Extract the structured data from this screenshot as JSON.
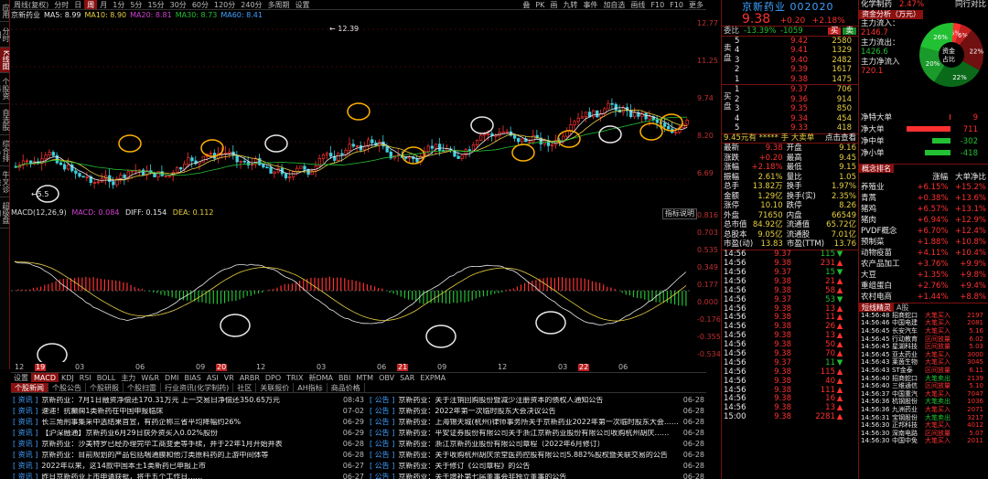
{
  "sidebar": {
    "items": [
      {
        "label": "应用",
        "active": false
      },
      {
        "label": "分时图",
        "active": false
      },
      {
        "label": "K线图",
        "active": true
      },
      {
        "label": "个股资料",
        "active": false
      },
      {
        "label": "自选股",
        "active": false
      },
      {
        "label": "综合排名",
        "active": false
      },
      {
        "label": "牛叉诊股",
        "active": false
      },
      {
        "label": "超级盘口",
        "active": false
      }
    ]
  },
  "toolbar": {
    "periods": [
      "周线(复权)",
      "分时",
      "日",
      "周",
      "月",
      "1分",
      "5分",
      "15分",
      "30分",
      "60分",
      "120分",
      "240分",
      "多周期",
      "设置"
    ],
    "active_period": "周",
    "right_buttons": [
      "叠",
      "PK",
      "画",
      "九转",
      "事件",
      "加自选",
      "画线",
      "F10",
      "F10",
      "更多"
    ]
  },
  "ma_line": {
    "stock": "京新药业",
    "items": [
      {
        "label": "MA5: 8.99",
        "color": "#e8e8e8"
      },
      {
        "label": "MA10: 8.90",
        "color": "#e8d040"
      },
      {
        "label": "MA20: 8.81",
        "color": "#d040d0"
      },
      {
        "label": "MA30: 8.73",
        "color": "#22c033"
      },
      {
        "label": "MA60: 8.41",
        "color": "#40a0ff"
      }
    ]
  },
  "chart_axis": {
    "price_ticks": [
      "12.77",
      "11.25",
      "9.74",
      "8.20",
      "6.69"
    ],
    "high_label": "12.39",
    "low_label": "5.5",
    "macd_ticks": [
      "0.816",
      "0.703",
      "0.535",
      "0.349",
      "0.177",
      "0.000",
      "-0.176",
      "-0.355",
      "-0.534"
    ],
    "time_labels": [
      "12",
      "03",
      "06",
      "09",
      "12",
      "03",
      "06",
      "09",
      "12",
      "03",
      "06"
    ],
    "year_badges": [
      "19",
      "20",
      "21",
      "22"
    ],
    "indicator_btn": "指标说明"
  },
  "macd": {
    "title": "MACD(12,26,9)",
    "macd_val": "MACD: 0.084",
    "diff": "DIFF: 0.154",
    "dea": "DEA: 0.112"
  },
  "indicators": {
    "items": [
      "设置",
      "MACD",
      "KDJ",
      "RSI",
      "BOLL",
      "主力",
      "W&R",
      "DMI",
      "BIAS",
      "ASI",
      "VR",
      "ARBR",
      "DPO",
      "TRIX",
      "新DMA",
      "BBI",
      "MTM",
      "OBV",
      "SAR",
      "EXPMA"
    ],
    "active": "MACD"
  },
  "news_tabs": {
    "items": [
      "个股新闻",
      "个股公告",
      "个股研报",
      "个股扫雷",
      "行业资讯(化学制药)",
      "社区",
      "关联报价",
      "AH指标",
      "商品价格"
    ],
    "active": "个股新闻"
  },
  "news": [
    {
      "tag": "资讯",
      "title": "京新药业：7月1日融资净偿还170.31万元 上一交易日净偿还350.65万元",
      "time": "08:43"
    },
    {
      "tag": "资讯",
      "title": "速递！抗癫痫1类新药在中国申报临床",
      "time": "07-02"
    },
    {
      "tag": "资讯",
      "title": "长三角刑事集采中选结果首宣，有药企称三省平均降幅约26%",
      "time": "06-29"
    },
    {
      "tag": "资讯",
      "title": "【沪深融通】京新药业6月29日获外资买入0.02%股份",
      "time": "06-29"
    },
    {
      "tag": "资讯",
      "title": "京新药业：沙美特罗已经办理完毕工商变更等手续，并于22年1月开始并表",
      "time": "06-28"
    },
    {
      "tag": "资讯",
      "title": "京新药业：目前规划的产品包括喘通膜和他汀类原料药的上游中间体等",
      "time": "06-28"
    },
    {
      "tag": "资讯",
      "title": "2022年以来，这14款中国本土1类新药已申报上市",
      "time": "06-27"
    },
    {
      "tag": "资讯",
      "title": "昨日京新药业上市申请获批，将于五个工作日……",
      "time": "06-27"
    }
  ],
  "notices": [
    {
      "tag": "公告",
      "title": "京新药业：关于注销回购股份暨减少注册资本的债权人通知公告",
      "time": "06-28"
    },
    {
      "tag": "公告",
      "title": "京新药业：2022年第一次临时股东大会决议公告",
      "time": "06-28"
    },
    {
      "tag": "公告",
      "title": "京新药业：上海锦天城(杭州)律师事务所关于京新药业2022年第一次临时股东大会……",
      "time": "06-28"
    },
    {
      "tag": "公告",
      "title": "京新药业：平安证券股份有限公司关于浙江京新药业股份有限公司收购杭州胡庆……",
      "time": "06-28"
    },
    {
      "tag": "公告",
      "title": "京新药业：浙江京新药业股份有限公司章程（2022年6月修订）",
      "time": "06-28"
    },
    {
      "tag": "公告",
      "title": "京新药业：关于收购杭州胡庆余堂医药控股有限公司5.882%股权暨关联交易的公告",
      "time": "06-28"
    },
    {
      "tag": "公告",
      "title": "京新药业：关于修订《公司章程》的公告",
      "time": "06-28"
    },
    {
      "tag": "公告",
      "title": "京新药业：关于增补第七届董事会非独立董事的公告",
      "time": "06-28"
    }
  ],
  "stock": {
    "name": "京新药业 002020",
    "price": "9.38",
    "change": "+0.20",
    "pct": "+2.18%",
    "weibi": "委比",
    "weibi_pct": "-13.39%",
    "weibi_val": "-1059",
    "buy_btn": "买",
    "sell_btn": "卖",
    "sells": [
      {
        "lvl": "5",
        "price": "9.42",
        "vol": "2580"
      },
      {
        "lvl": "4",
        "price": "9.41",
        "vol": "1329"
      },
      {
        "lvl": "3",
        "price": "9.40",
        "vol": "2482"
      },
      {
        "lvl": "2",
        "price": "9.39",
        "vol": "1617"
      },
      {
        "lvl": "1",
        "price": "9.38",
        "vol": "1475"
      }
    ],
    "buys": [
      {
        "lvl": "1",
        "price": "9.37",
        "vol": "706"
      },
      {
        "lvl": "2",
        "price": "9.36",
        "vol": "914"
      },
      {
        "lvl": "3",
        "price": "9.35",
        "vol": "850"
      },
      {
        "lvl": "4",
        "price": "9.34",
        "vol": "454"
      },
      {
        "lvl": "5",
        "price": "9.33",
        "vol": "418"
      }
    ],
    "sell_side_label": "卖盘",
    "buy_side_label": "买盘",
    "mini_hdr": "9.45元有 ***** 手 大卖单",
    "mini_hdr_right": "点击查看",
    "stats": [
      {
        "k": "最新",
        "v": "9.38",
        "k2": "开盘",
        "v2": "9.16"
      },
      {
        "k": "涨跌",
        "v": "+0.20",
        "k2": "最高",
        "v2": "9.45"
      },
      {
        "k": "涨幅",
        "v": "+2.18%",
        "k2": "最低",
        "v2": "9.15"
      },
      {
        "k": "振幅",
        "v": "2.61%",
        "k2": "量比",
        "v2": "1.05"
      },
      {
        "k": "总手",
        "v": "13.82万",
        "k2": "换手",
        "v2": "1.97%"
      },
      {
        "k": "金额",
        "v": "1.29亿",
        "k2": "换手(实)",
        "v2": "2.35%"
      },
      {
        "k": "涨停",
        "v": "10.10",
        "k2": "跌停",
        "v2": "8.26"
      },
      {
        "k": "外盘",
        "v": "71650",
        "k2": "内盘",
        "v2": "66549"
      },
      {
        "k": "总市值",
        "v": "84.92亿",
        "k2": "流通值",
        "v2": "65.72亿"
      },
      {
        "k": "总股本",
        "v": "9.05亿",
        "k2": "流通股",
        "v2": "7.01亿"
      },
      {
        "k": "市盈(动)",
        "v": "13.83",
        "k2": "市盈(TTM)",
        "v2": "13.76"
      }
    ],
    "ticks": [
      {
        "t": "14:56",
        "p": "9.37",
        "v": "115",
        "d": "s"
      },
      {
        "t": "14:56",
        "p": "9.38",
        "v": "231",
        "d": "b"
      },
      {
        "t": "14:56",
        "p": "9.37",
        "v": "15",
        "d": "s"
      },
      {
        "t": "14:56",
        "p": "9.38",
        "v": "21",
        "d": "b"
      },
      {
        "t": "14:56",
        "p": "9.38",
        "v": "58",
        "d": "b"
      },
      {
        "t": "14:56",
        "p": "9.37",
        "v": "53",
        "d": "s"
      },
      {
        "t": "14:56",
        "p": "9.38",
        "v": "13",
        "d": "b"
      },
      {
        "t": "14:56",
        "p": "9.38",
        "v": "11",
        "d": "b"
      },
      {
        "t": "14:56",
        "p": "9.38",
        "v": "26",
        "d": "b"
      },
      {
        "t": "14:56",
        "p": "9.38",
        "v": "13",
        "d": "b"
      },
      {
        "t": "14:56",
        "p": "9.38",
        "v": "50",
        "d": "b"
      },
      {
        "t": "14:56",
        "p": "9.38",
        "v": "70",
        "d": "b"
      },
      {
        "t": "14:56",
        "p": "9.37",
        "v": "11",
        "d": "s"
      },
      {
        "t": "14:56",
        "p": "9.38",
        "v": "115",
        "d": "b"
      },
      {
        "t": "14:56",
        "p": "9.38",
        "v": "40",
        "d": "b"
      },
      {
        "t": "14:56",
        "p": "9.38",
        "v": "111",
        "d": "b"
      },
      {
        "t": "14:56",
        "p": "9.38",
        "v": "16",
        "d": "b"
      },
      {
        "t": "14:56",
        "p": "9.38",
        "v": "13",
        "d": "b"
      },
      {
        "t": "15:00",
        "p": "9.38",
        "v": "2281",
        "d": "b"
      }
    ]
  },
  "fund": {
    "industry": "化学制药",
    "industry_pct": "2.47%",
    "industry_link": "同行对比",
    "tabs": [
      "资金分析（万元）"
    ],
    "main_in_lbl": "主力流入：",
    "main_in": "2146.7",
    "main_out_lbl": "主力流出：",
    "main_out": "1426.6",
    "main_net_lbl": "主力净流入",
    "main_net": "720.1",
    "pie_center": "资金占比",
    "pie_pcts": [
      "5%",
      "6%",
      "22%",
      "22%",
      "20%",
      "26%"
    ],
    "flows": [
      {
        "k": "净特大单",
        "v": "9",
        "frac": 0.01,
        "color": "#ff3030"
      },
      {
        "k": "净大单",
        "v": "711",
        "frac": 0.85,
        "color": "#ff3030"
      },
      {
        "k": "净中单",
        "v": "-302",
        "frac": 0.35,
        "color": "#22c033"
      },
      {
        "k": "净小单",
        "v": "-418",
        "frac": 0.5,
        "color": "#22c033"
      }
    ],
    "rank_title": "概念排名",
    "rank_cols": [
      "涨幅",
      "大单净比"
    ],
    "ranks": [
      {
        "n": "养殖业",
        "a": "+6.15%",
        "b": "+15.2%"
      },
      {
        "n": "青蒿",
        "a": "+0.38%",
        "b": "+13.6%"
      },
      {
        "n": "猪鸡",
        "a": "+6.57%",
        "b": "+13.1%"
      },
      {
        "n": "猪肉",
        "a": "+6.94%",
        "b": "+12.9%"
      },
      {
        "n": "PVDF概念",
        "a": "+6.70%",
        "b": "+12.4%"
      },
      {
        "n": "预制菜",
        "a": "+1.88%",
        "b": "+10.8%"
      },
      {
        "n": "动物疫苗",
        "a": "+4.11%",
        "b": "+10.4%"
      },
      {
        "n": "农产品加工",
        "a": "+3.76%",
        "b": "+9.9%"
      },
      {
        "n": "大豆",
        "a": "+1.35%",
        "b": "+9.8%"
      },
      {
        "n": "重组蛋白",
        "a": "+2.76%",
        "b": "+9.4%"
      },
      {
        "n": "农村电商",
        "a": "+1.44%",
        "b": "+8.8%"
      }
    ],
    "mini_tabs": [
      "短线精灵",
      "A股"
    ],
    "alerts": [
      {
        "t": "14:56:48",
        "n": "招商蛇口",
        "e": "大笔买入",
        "v": "2197"
      },
      {
        "t": "14:56:46",
        "n": "中国电建",
        "e": "大笔买入",
        "v": "2081"
      },
      {
        "t": "14:56:45",
        "n": "长安汽车",
        "e": "大笔买入",
        "v": "5.16"
      },
      {
        "t": "14:56:45",
        "n": "行动教育",
        "e": "区间放量",
        "v": "6.02"
      },
      {
        "t": "14:56:45",
        "n": "星湖科技",
        "e": "区间放量",
        "v": "5.03"
      },
      {
        "t": "14:56:45",
        "n": "亚太药业",
        "e": "大笔买入",
        "v": "3000"
      },
      {
        "t": "14:56:43",
        "n": "莱茵生物",
        "e": "大笔买入",
        "v": "3045"
      },
      {
        "t": "14:56:43",
        "n": "ST金泰",
        "e": "区间放量",
        "v": "6.11"
      },
      {
        "t": "14:56:40",
        "n": "招商蛇口",
        "e": "大笔卖出",
        "v": "2139"
      },
      {
        "t": "14:56:40",
        "n": "三维通信",
        "e": "区间放量",
        "v": "5.10"
      },
      {
        "t": "14:56:37",
        "n": "中国重汽",
        "e": "大笔买入",
        "v": "7047"
      },
      {
        "t": "14:56:36",
        "n": "杭钢股份",
        "e": "大笔卖出",
        "v": "1036"
      },
      {
        "t": "14:56:36",
        "n": "九洲药业",
        "e": "大笔买入",
        "v": "2071"
      },
      {
        "t": "14:56:31",
        "n": "宝钢股份",
        "e": "大笔卖出",
        "v": "3217"
      },
      {
        "t": "14:56:30",
        "n": "正邦科技",
        "e": "大笔买入",
        "v": "4012"
      },
      {
        "t": "14:56:30",
        "n": "深南电路",
        "e": "区间放量",
        "v": "5.07"
      },
      {
        "t": "14:56:30",
        "n": "中国中免",
        "e": "大笔买入",
        "v": "2011"
      }
    ]
  },
  "colors": {
    "up": "#ff3030",
    "down": "#22c033",
    "accent": "#8b1010",
    "highlight": "#ffb000"
  }
}
